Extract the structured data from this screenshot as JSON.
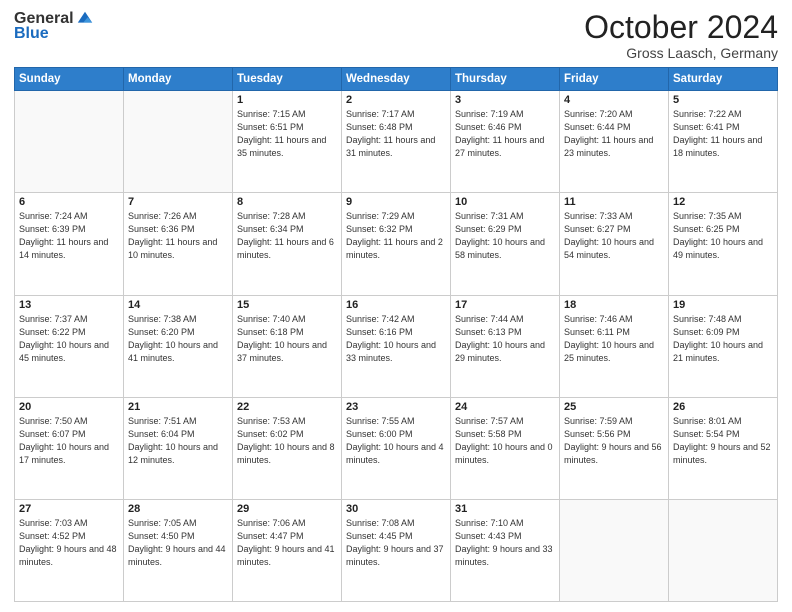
{
  "header": {
    "logo": {
      "general": "General",
      "blue": "Blue"
    },
    "month": "October 2024",
    "location": "Gross Laasch, Germany"
  },
  "weekdays": [
    "Sunday",
    "Monday",
    "Tuesday",
    "Wednesday",
    "Thursday",
    "Friday",
    "Saturday"
  ],
  "weeks": [
    [
      {
        "day": "",
        "info": ""
      },
      {
        "day": "",
        "info": ""
      },
      {
        "day": "1",
        "info": "Sunrise: 7:15 AM\nSunset: 6:51 PM\nDaylight: 11 hours and 35 minutes."
      },
      {
        "day": "2",
        "info": "Sunrise: 7:17 AM\nSunset: 6:48 PM\nDaylight: 11 hours and 31 minutes."
      },
      {
        "day": "3",
        "info": "Sunrise: 7:19 AM\nSunset: 6:46 PM\nDaylight: 11 hours and 27 minutes."
      },
      {
        "day": "4",
        "info": "Sunrise: 7:20 AM\nSunset: 6:44 PM\nDaylight: 11 hours and 23 minutes."
      },
      {
        "day": "5",
        "info": "Sunrise: 7:22 AM\nSunset: 6:41 PM\nDaylight: 11 hours and 18 minutes."
      }
    ],
    [
      {
        "day": "6",
        "info": "Sunrise: 7:24 AM\nSunset: 6:39 PM\nDaylight: 11 hours and 14 minutes."
      },
      {
        "day": "7",
        "info": "Sunrise: 7:26 AM\nSunset: 6:36 PM\nDaylight: 11 hours and 10 minutes."
      },
      {
        "day": "8",
        "info": "Sunrise: 7:28 AM\nSunset: 6:34 PM\nDaylight: 11 hours and 6 minutes."
      },
      {
        "day": "9",
        "info": "Sunrise: 7:29 AM\nSunset: 6:32 PM\nDaylight: 11 hours and 2 minutes."
      },
      {
        "day": "10",
        "info": "Sunrise: 7:31 AM\nSunset: 6:29 PM\nDaylight: 10 hours and 58 minutes."
      },
      {
        "day": "11",
        "info": "Sunrise: 7:33 AM\nSunset: 6:27 PM\nDaylight: 10 hours and 54 minutes."
      },
      {
        "day": "12",
        "info": "Sunrise: 7:35 AM\nSunset: 6:25 PM\nDaylight: 10 hours and 49 minutes."
      }
    ],
    [
      {
        "day": "13",
        "info": "Sunrise: 7:37 AM\nSunset: 6:22 PM\nDaylight: 10 hours and 45 minutes."
      },
      {
        "day": "14",
        "info": "Sunrise: 7:38 AM\nSunset: 6:20 PM\nDaylight: 10 hours and 41 minutes."
      },
      {
        "day": "15",
        "info": "Sunrise: 7:40 AM\nSunset: 6:18 PM\nDaylight: 10 hours and 37 minutes."
      },
      {
        "day": "16",
        "info": "Sunrise: 7:42 AM\nSunset: 6:16 PM\nDaylight: 10 hours and 33 minutes."
      },
      {
        "day": "17",
        "info": "Sunrise: 7:44 AM\nSunset: 6:13 PM\nDaylight: 10 hours and 29 minutes."
      },
      {
        "day": "18",
        "info": "Sunrise: 7:46 AM\nSunset: 6:11 PM\nDaylight: 10 hours and 25 minutes."
      },
      {
        "day": "19",
        "info": "Sunrise: 7:48 AM\nSunset: 6:09 PM\nDaylight: 10 hours and 21 minutes."
      }
    ],
    [
      {
        "day": "20",
        "info": "Sunrise: 7:50 AM\nSunset: 6:07 PM\nDaylight: 10 hours and 17 minutes."
      },
      {
        "day": "21",
        "info": "Sunrise: 7:51 AM\nSunset: 6:04 PM\nDaylight: 10 hours and 12 minutes."
      },
      {
        "day": "22",
        "info": "Sunrise: 7:53 AM\nSunset: 6:02 PM\nDaylight: 10 hours and 8 minutes."
      },
      {
        "day": "23",
        "info": "Sunrise: 7:55 AM\nSunset: 6:00 PM\nDaylight: 10 hours and 4 minutes."
      },
      {
        "day": "24",
        "info": "Sunrise: 7:57 AM\nSunset: 5:58 PM\nDaylight: 10 hours and 0 minutes."
      },
      {
        "day": "25",
        "info": "Sunrise: 7:59 AM\nSunset: 5:56 PM\nDaylight: 9 hours and 56 minutes."
      },
      {
        "day": "26",
        "info": "Sunrise: 8:01 AM\nSunset: 5:54 PM\nDaylight: 9 hours and 52 minutes."
      }
    ],
    [
      {
        "day": "27",
        "info": "Sunrise: 7:03 AM\nSunset: 4:52 PM\nDaylight: 9 hours and 48 minutes."
      },
      {
        "day": "28",
        "info": "Sunrise: 7:05 AM\nSunset: 4:50 PM\nDaylight: 9 hours and 44 minutes."
      },
      {
        "day": "29",
        "info": "Sunrise: 7:06 AM\nSunset: 4:47 PM\nDaylight: 9 hours and 41 minutes."
      },
      {
        "day": "30",
        "info": "Sunrise: 7:08 AM\nSunset: 4:45 PM\nDaylight: 9 hours and 37 minutes."
      },
      {
        "day": "31",
        "info": "Sunrise: 7:10 AM\nSunset: 4:43 PM\nDaylight: 9 hours and 33 minutes."
      },
      {
        "day": "",
        "info": ""
      },
      {
        "day": "",
        "info": ""
      }
    ]
  ]
}
